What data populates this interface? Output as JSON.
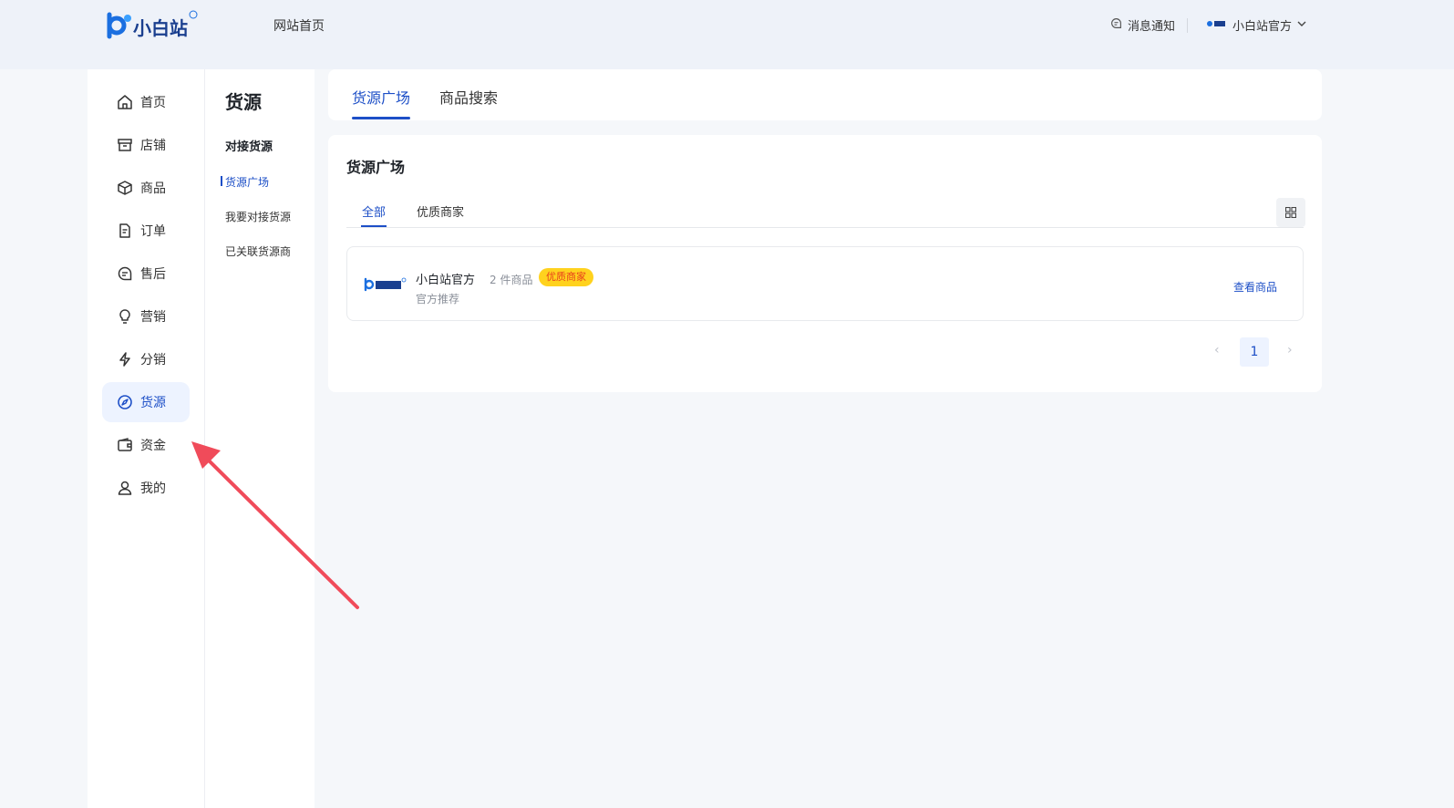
{
  "header": {
    "logo_text": "小白站",
    "site_home": "网站首页",
    "notice": "消息通知",
    "account": "小白站官方"
  },
  "sidebar": {
    "items": [
      {
        "label": "首页",
        "icon": "home-icon"
      },
      {
        "label": "店铺",
        "icon": "store-icon"
      },
      {
        "label": "商品",
        "icon": "box-icon"
      },
      {
        "label": "订单",
        "icon": "order-icon"
      },
      {
        "label": "售后",
        "icon": "chat-icon"
      },
      {
        "label": "营销",
        "icon": "bulb-icon"
      },
      {
        "label": "分销",
        "icon": "bolt-icon"
      },
      {
        "label": "货源",
        "icon": "compass-icon",
        "active": true
      },
      {
        "label": "资金",
        "icon": "wallet-icon"
      },
      {
        "label": "我的",
        "icon": "user-icon"
      }
    ]
  },
  "subnav": {
    "title": "货源",
    "group": "对接货源",
    "items": [
      "货源广场",
      "我要对接货源",
      "已关联货源商"
    ]
  },
  "main": {
    "tabs": [
      "货源广场",
      "商品搜索"
    ],
    "card_title": "货源广场",
    "filter_tabs": [
      "全部",
      "优质商家"
    ]
  },
  "supplier": {
    "name": "小白站官方",
    "count": "2 件商品",
    "badge": "优质商家",
    "tag": "官方推荐",
    "action": "查看商品"
  },
  "pagination": {
    "current": "1",
    "prev": "‹",
    "next": "›"
  },
  "colors": {
    "accent": "#1d4fc7",
    "badge_bg": "#ffd21e",
    "badge_text": "#e8411c",
    "annotation_arrow": "#f04b5a"
  }
}
